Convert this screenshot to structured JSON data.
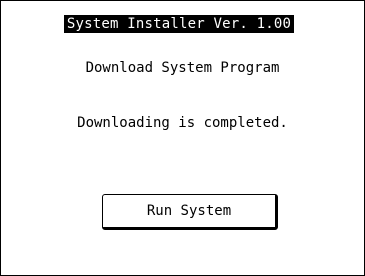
{
  "header": {
    "title": "System Installer  Ver. 1.00"
  },
  "main": {
    "subtitle": "Download System Program",
    "message": "Downloading is completed."
  },
  "actions": {
    "run_label": "Run System"
  },
  "colors": {
    "background": "#ffffff",
    "foreground": "#000000",
    "title_bar": "#000000",
    "title_text": "#ffffff"
  }
}
